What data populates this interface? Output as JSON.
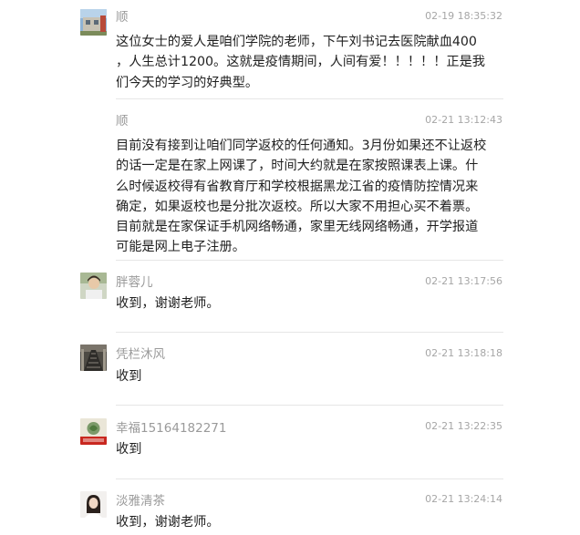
{
  "comments": [
    {
      "name": "顺",
      "time": "02-19 18:35:32",
      "avatar": "house-photo-avatar",
      "lines": [
        "这位女士的爱人是咱们学院的老师，下午刘书记去医院献血400",
        "，人生总计1200。这就是疫情期间，人间有爱！！！！！正是我",
        "们今天的学习的好典型。"
      ]
    },
    {
      "name": "顺",
      "time": "02-21 13:12:43",
      "avatar": "",
      "lines": [
        "目前没有接到让咱们同学返校的任何通知。3月份如果还不让返校",
        "的话一定是在家上网课了，时间大约就是在家按照课表上课。什",
        "么时候返校得有省教育厅和学校根据黑龙江省的疫情防控情况来",
        "确定，如果返校也是分批次返校。所以大家不用担心买不着票。",
        "目前就是在家保证手机网络畅通，家里无线网络畅通，开学报道",
        "可能是网上电子注册。"
      ]
    },
    {
      "name": "胖蓉儿",
      "time": "02-21 13:17:56",
      "avatar": "person-photo-avatar",
      "lines": [
        "收到，谢谢老师。"
      ]
    },
    {
      "name": "凭栏沐风",
      "time": "02-21 13:18:18",
      "avatar": "escalator-photo-avatar",
      "lines": [
        "收到"
      ]
    },
    {
      "name": "幸福15164182271",
      "time": "02-21 13:22:35",
      "avatar": "china-refuel-avatar",
      "lines": [
        "收到"
      ]
    },
    {
      "name": "淡雅清茶",
      "time": "02-21 13:24:14",
      "avatar": "woman-portrait-avatar",
      "lines": [
        "收到，谢谢老师。"
      ]
    }
  ]
}
